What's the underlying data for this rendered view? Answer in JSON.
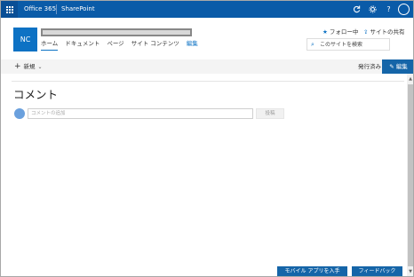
{
  "suite": {
    "app_name": "Office 365",
    "product": "SharePoint",
    "icons": [
      "waffle-icon",
      "refresh-icon",
      "gear-icon",
      "help-icon",
      "user-avatar-icon"
    ],
    "help_glyph": "?"
  },
  "site": {
    "logo_initials": "NC",
    "nav": [
      {
        "label": "ホーム",
        "active": true
      },
      {
        "label": "ドキュメント"
      },
      {
        "label": "ページ"
      },
      {
        "label": "サイト コンテンツ"
      },
      {
        "label": "編集"
      }
    ],
    "follow_label": "フォロー中",
    "share_label": "サイトの共有",
    "search_placeholder": "このサイトを検索"
  },
  "commandbar": {
    "new_label": "新規",
    "published_label": "発行済み",
    "edit_label": "編集"
  },
  "comments": {
    "title": "コメント",
    "avatar_initial": "",
    "input_placeholder": "コメントの追加",
    "post_label": "投稿"
  },
  "footer": {
    "mobile_label": "モバイル アプリを入手",
    "feedback_label": "フィードバック"
  },
  "colors": {
    "suitebar": "#0a5ba8",
    "accent": "#0d72c4",
    "button": "#1565a8"
  }
}
